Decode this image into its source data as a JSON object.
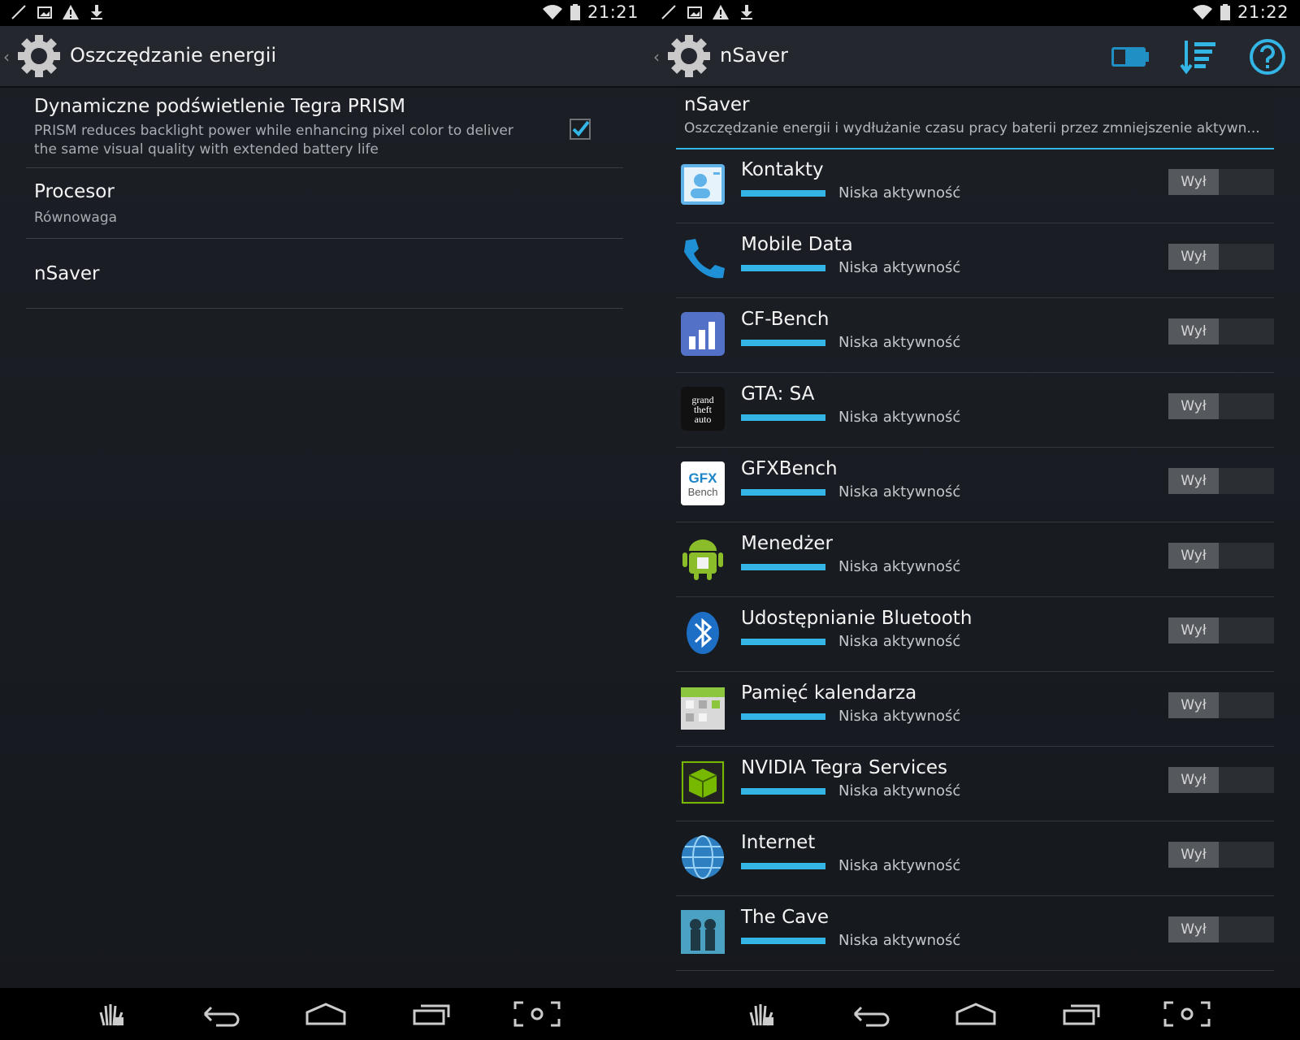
{
  "left": {
    "status": {
      "time": "21:21"
    },
    "actionbar": {
      "title": "Oszczędzanie energii"
    },
    "prefs": [
      {
        "title": "Dynamiczne podświetlenie Tegra PRISM",
        "summary": "PRISM reduces backlight power while enhancing pixel color to deliver the same visual quality with extended battery life",
        "checked": true
      },
      {
        "title": "Procesor",
        "summary": "Równowaga"
      },
      {
        "title": "nSaver",
        "summary": ""
      }
    ]
  },
  "right": {
    "status": {
      "time": "21:22"
    },
    "actionbar": {
      "title": "nSaver",
      "actions": [
        "battery-toggle-icon",
        "sort-icon",
        "help-icon"
      ]
    },
    "header": {
      "title": "nSaver",
      "summary": "Oszczędzanie energii i wydłużanie czasu pracy baterii przez zmniejszenie aktywn..."
    },
    "apps": [
      {
        "name": "Kontakty",
        "level": "Niska aktywność",
        "toggle": "Wył",
        "icon": "contacts-icon"
      },
      {
        "name": "Mobile Data",
        "level": "Niska aktywność",
        "toggle": "Wył",
        "icon": "phone-icon"
      },
      {
        "name": "CF-Bench",
        "level": "Niska aktywność",
        "toggle": "Wył",
        "icon": "cfbench-icon"
      },
      {
        "name": "GTA: SA",
        "level": "Niska aktywność",
        "toggle": "Wył",
        "icon": "gta-icon"
      },
      {
        "name": "GFXBench",
        "level": "Niska aktywność",
        "toggle": "Wył",
        "icon": "gfxbench-icon"
      },
      {
        "name": "Menedżer",
        "level": "Niska aktywność",
        "toggle": "Wył",
        "icon": "android-icon"
      },
      {
        "name": "Udostępnianie Bluetooth",
        "level": "Niska aktywność",
        "toggle": "Wył",
        "icon": "bluetooth-icon"
      },
      {
        "name": "Pamięć kalendarza",
        "level": "Niska aktywność",
        "toggle": "Wył",
        "icon": "calendar-icon"
      },
      {
        "name": "NVIDIA Tegra Services",
        "level": "Niska aktywność",
        "toggle": "Wył",
        "icon": "nvidia-cube-icon"
      },
      {
        "name": "Internet",
        "level": "Niska aktywność",
        "toggle": "Wył",
        "icon": "globe-icon"
      },
      {
        "name": "The Cave",
        "level": "Niska aktywność",
        "toggle": "Wył",
        "icon": "the-cave-icon"
      }
    ]
  },
  "colors": {
    "accent": "#33b5e5",
    "background": "#1a1d22",
    "actionbar": "#24282e"
  }
}
